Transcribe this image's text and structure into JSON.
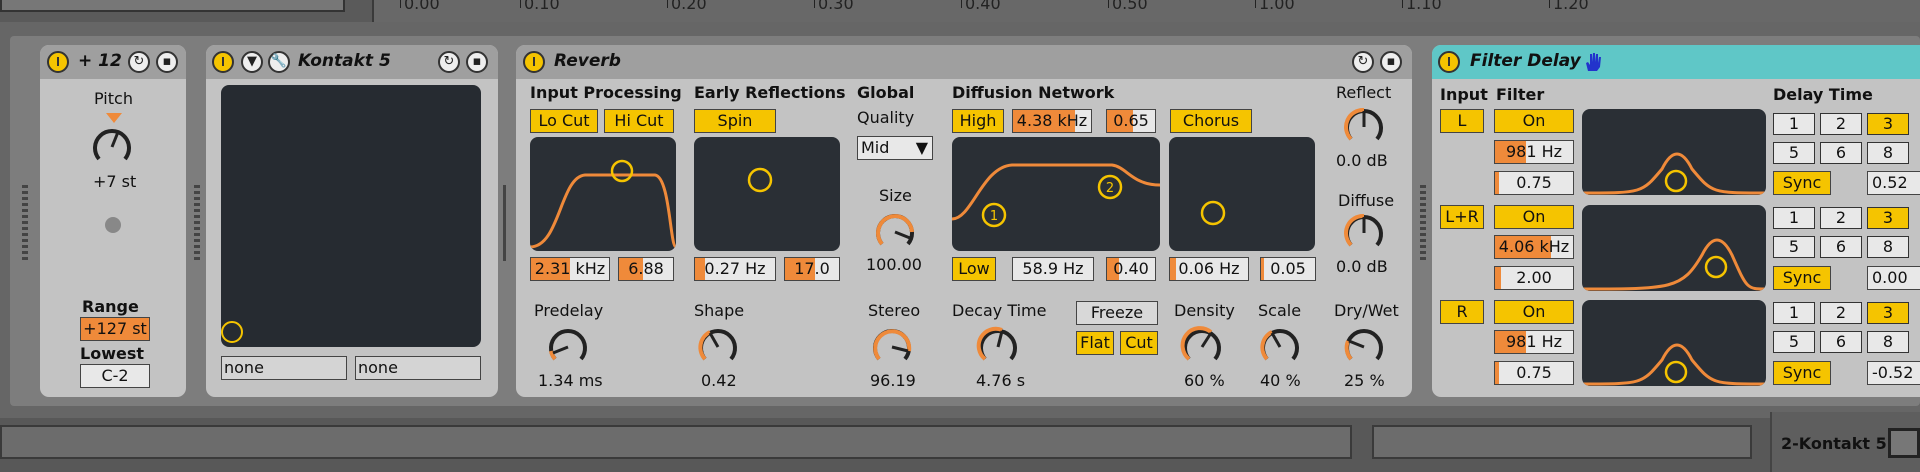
{
  "ruler": {
    "ticks": [
      "0.00",
      "0.10",
      "0.20",
      "0.30",
      "0.40",
      "0.50",
      "1.00",
      "1.10",
      "1.20"
    ]
  },
  "pitch": {
    "title": "+ 12",
    "label": "Pitch",
    "value": "+7 st",
    "range_label": "Range",
    "range_value": "+127 st",
    "lowest_label": "Lowest",
    "lowest_value": "C-2"
  },
  "kontakt": {
    "title": "Kontakt 5",
    "field_left": "none",
    "field_right": "none"
  },
  "reverb": {
    "title": "Reverb",
    "input_processing": {
      "label": "Input Processing",
      "locut": "Lo Cut",
      "hicut": "Hi Cut",
      "freq": "2.31 kHz",
      "freq_fill": 0.5,
      "q": "6.88",
      "q_fill": 0.45
    },
    "early": {
      "label": "Early Reflections",
      "spin": "Spin",
      "rate": "0.27 Hz",
      "rate_fill": 0.12,
      "amount": "17.0",
      "amount_fill": 0.55
    },
    "global": {
      "label": "Global",
      "quality_label": "Quality",
      "quality_value": "Mid",
      "size_label": "Size",
      "size_value": "100.00",
      "stereo_label": "Stereo",
      "stereo_value": "96.19"
    },
    "diffusion": {
      "label": "Diffusion Network",
      "high": "High",
      "high_freq": "4.38 kHz",
      "high_freq_fill": 0.8,
      "high_val": "0.65",
      "high_val_fill": 0.55,
      "low": "Low",
      "low_freq": "58.9 Hz",
      "low_freq_fill": 0.0,
      "low_val": "0.40",
      "low_val_fill": 0.25,
      "chorus": "Chorus",
      "chorus_rate": "0.06 Hz",
      "chorus_rate_fill": 0.08,
      "chorus_amt": "0.05",
      "chorus_amt_fill": 0.05
    },
    "reflect_label": "Reflect",
    "reflect_value": "0.0 dB",
    "diffuse_label": "Diffuse",
    "diffuse_value": "0.0 dB",
    "predelay_label": "Predelay",
    "predelay_value": "1.34 ms",
    "shape_label": "Shape",
    "shape_value": "0.42",
    "decay_label": "Decay Time",
    "decay_value": "4.76 s",
    "freeze": "Freeze",
    "flat": "Flat",
    "cut": "Cut",
    "density_label": "Density",
    "density_value": "60 %",
    "scale_label": "Scale",
    "scale_value": "40 %",
    "drywet_label": "Dry/Wet",
    "drywet_value": "25 %",
    "markers": {
      "m1": "1",
      "m2": "2"
    }
  },
  "filter_delay": {
    "title": "Filter Delay",
    "input_label": "Input",
    "filter_label": "Filter",
    "delay_time_label": "Delay Time",
    "rows": [
      {
        "input": "L",
        "on": "On",
        "freq": "981 Hz",
        "freq_fill": 0.4,
        "q": "0.75",
        "q_fill": 0.05,
        "sync": "Sync",
        "value": "0.52"
      },
      {
        "input": "L+R",
        "on": "On",
        "freq": "4.06 kHz",
        "freq_fill": 0.72,
        "q": "2.00",
        "q_fill": 0.08,
        "sync": "Sync",
        "value": "0.00"
      },
      {
        "input": "R",
        "on": "On",
        "freq": "981 Hz",
        "freq_fill": 0.4,
        "q": "0.75",
        "q_fill": 0.05,
        "sync": "Sync",
        "value": "-0.52"
      }
    ],
    "digits": [
      "1",
      "2",
      "3",
      "5",
      "6",
      "8"
    ]
  },
  "bottom": {
    "track_name": "2-Kontakt 5"
  },
  "colors": {
    "accent": "#f5c400",
    "orange": "#ef8a3a",
    "screen": "#262b31",
    "filterdelay_header": "#5fc7c7",
    "hand": "#2233cc"
  }
}
